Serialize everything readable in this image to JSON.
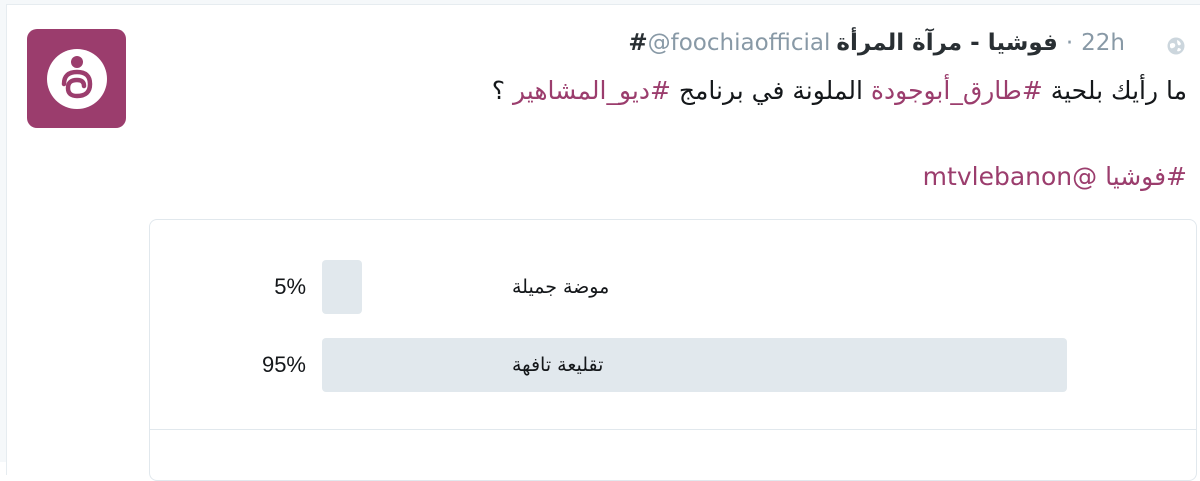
{
  "tweet": {
    "time": "22h",
    "separator": "·",
    "fullname": "فوشيا - مرآة المرأة",
    "handle": "@foochiaofficial",
    "hash_prefix": "#",
    "text_line1": {
      "part1": "ما رأيك بلحية ",
      "hashtag1": "#طارق_أبوجودة",
      "part2": " الملونة في برنامج ",
      "hashtag2": "#ديو_المشاهير",
      "part3": " ؟"
    },
    "text_line2": {
      "hashtag": "#فوشيا",
      "space": " ",
      "mention": "@mtvlebanon"
    }
  },
  "poll": {
    "choices": [
      {
        "label": "موضة جميلة",
        "percent_text": "5%",
        "percent": 5
      },
      {
        "label": "تقليعة تافهة",
        "percent_text": "95%",
        "percent": 95
      }
    ]
  },
  "colors": {
    "brand": "#9b3d6d",
    "bar": "#e1e8ed",
    "muted": "#8899a6",
    "text": "#14171a"
  },
  "icons": {
    "avatar": "foochia-logo",
    "globe": "globe-icon"
  }
}
